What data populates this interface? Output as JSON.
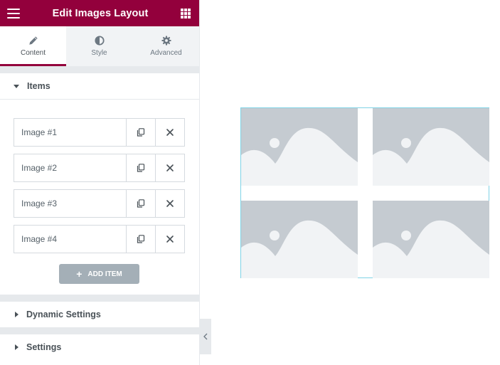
{
  "header": {
    "title": "Edit Images Layout",
    "menu_icon": "hamburger-icon",
    "apps_icon": "grid-icon"
  },
  "tabs": [
    {
      "label": "Content",
      "icon": "pencil-icon",
      "active": true
    },
    {
      "label": "Style",
      "icon": "contrast-icon",
      "active": false
    },
    {
      "label": "Advanced",
      "icon": "gear-icon",
      "active": false
    }
  ],
  "sections": {
    "items": {
      "label": "Items",
      "expanded": true
    },
    "dynamic": {
      "label": "Dynamic Settings",
      "expanded": false
    },
    "settings": {
      "label": "Settings",
      "expanded": false
    }
  },
  "items": [
    {
      "label": "Image #1"
    },
    {
      "label": "Image #2"
    },
    {
      "label": "Image #3"
    },
    {
      "label": "Image #4"
    }
  ],
  "add_button": {
    "label": "ADD ITEM"
  },
  "colors": {
    "brand": "#93003c",
    "placeholder_bg": "#c5cbd1",
    "placeholder_fg": "#f1f3f5",
    "selection_border": "#7fd3e6",
    "add_button": "#a4afb7"
  }
}
